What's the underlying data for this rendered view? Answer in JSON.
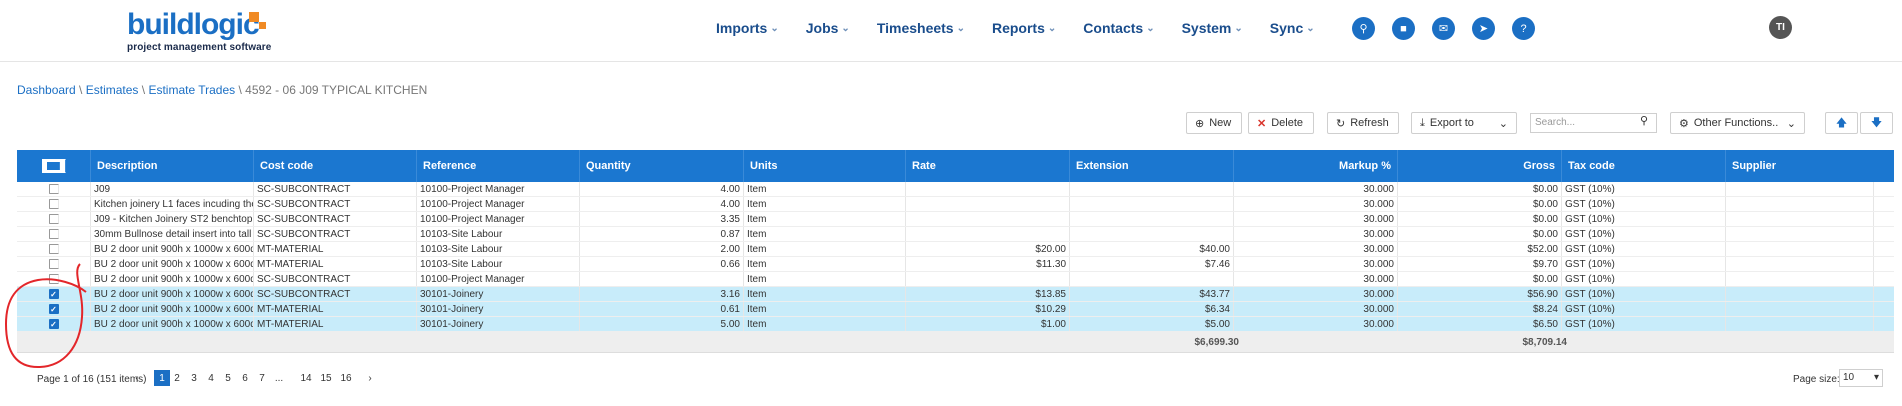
{
  "brand": {
    "name": "buildlogic",
    "tagline": "project management software",
    "accent": "#1b6fc4",
    "orange": "#f08a24"
  },
  "nav": [
    "Imports",
    "Jobs",
    "Timesheets",
    "Reports",
    "Contacts",
    "System",
    "Sync"
  ],
  "nav_icons": [
    "search-icon",
    "folder-icon",
    "mail-icon",
    "send-icon",
    "help-icon"
  ],
  "user_initials": "TI",
  "breadcrumb": {
    "dashboard": "Dashboard",
    "estimates": "Estimates",
    "estimate_trades": "Estimate Trades",
    "current": "4592 - 06 J09 TYPICAL KITCHEN",
    "sep": " \\ "
  },
  "toolbar": {
    "new": "New",
    "delete": "Delete",
    "refresh": "Refresh",
    "export": "Export to",
    "search_placeholder": "Search...",
    "other": "Other Functions.."
  },
  "columns": [
    "Description",
    "Cost code",
    "Reference",
    "Quantity",
    "Units",
    "Rate",
    "Extension",
    "Markup %",
    "Gross",
    "Tax code",
    "Supplier"
  ],
  "rows": [
    {
      "checked": false,
      "selected": false,
      "desc": "J09",
      "cost": "SC-SUBCONTRACT",
      "ref": "10100-Project Manager",
      "qty": "4.00",
      "units": "Item",
      "rate": "",
      "ext": "",
      "markup": "30.000",
      "gross": "$0.00",
      "tax": "GST (10%)"
    },
    {
      "checked": false,
      "selected": false,
      "desc": "Kitchen joinery L1 faces incuding the",
      "cost": "SC-SUBCONTRACT",
      "ref": "10100-Project Manager",
      "qty": "4.00",
      "units": "Item",
      "rate": "",
      "ext": "",
      "markup": "30.000",
      "gross": "$0.00",
      "tax": "GST (10%)"
    },
    {
      "checked": false,
      "selected": false,
      "desc": "J09 - Kitchen Joinery ST2 benchtop 8",
      "cost": "SC-SUBCONTRACT",
      "ref": "10100-Project Manager",
      "qty": "3.35",
      "units": "Item",
      "rate": "",
      "ext": "",
      "markup": "30.000",
      "gross": "$0.00",
      "tax": "GST (10%)"
    },
    {
      "checked": false,
      "selected": false,
      "desc": "30mm Bullnose detail insert into tall c",
      "cost": "SC-SUBCONTRACT",
      "ref": "10103-Site Labour",
      "qty": "0.87",
      "units": "Item",
      "rate": "",
      "ext": "",
      "markup": "30.000",
      "gross": "$0.00",
      "tax": "GST (10%)"
    },
    {
      "checked": false,
      "selected": false,
      "desc": "BU 2 door unit 900h x 1000w x 600d",
      "cost": "MT-MATERIAL",
      "ref": "10103-Site Labour",
      "qty": "2.00",
      "units": "Item",
      "rate": "$20.00",
      "ext": "$40.00",
      "markup": "30.000",
      "gross": "$52.00",
      "tax": "GST (10%)"
    },
    {
      "checked": false,
      "selected": false,
      "desc": "BU 2 door unit 900h x 1000w x 600d",
      "cost": "MT-MATERIAL",
      "ref": "10103-Site Labour",
      "qty": "0.66",
      "units": "Item",
      "rate": "$11.30",
      "ext": "$7.46",
      "markup": "30.000",
      "gross": "$9.70",
      "tax": "GST (10%)"
    },
    {
      "checked": false,
      "selected": false,
      "desc": "BU 2 door unit 900h x 1000w x 600d",
      "cost": "SC-SUBCONTRACT",
      "ref": "10100-Project Manager",
      "qty": "",
      "units": "Item",
      "rate": "",
      "ext": "",
      "markup": "30.000",
      "gross": "$0.00",
      "tax": "GST (10%)"
    },
    {
      "checked": true,
      "selected": true,
      "desc": "BU 2 door unit 900h x 1000w x 600d",
      "cost": "SC-SUBCONTRACT",
      "ref": "30101-Joinery",
      "qty": "3.16",
      "units": "Item",
      "rate": "$13.85",
      "ext": "$43.77",
      "markup": "30.000",
      "gross": "$56.90",
      "tax": "GST (10%)"
    },
    {
      "checked": true,
      "selected": true,
      "desc": "BU 2 door unit 900h x 1000w x 600d",
      "cost": "MT-MATERIAL",
      "ref": "30101-Joinery",
      "qty": "0.61",
      "units": "Item",
      "rate": "$10.29",
      "ext": "$6.34",
      "markup": "30.000",
      "gross": "$8.24",
      "tax": "GST (10%)"
    },
    {
      "checked": true,
      "selected": true,
      "desc": "BU 2 door unit 900h x 1000w x 600d",
      "cost": "MT-MATERIAL",
      "ref": "30101-Joinery",
      "qty": "5.00",
      "units": "Item",
      "rate": "$1.00",
      "ext": "$5.00",
      "markup": "30.000",
      "gross": "$6.50",
      "tax": "GST (10%)"
    }
  ],
  "totals": {
    "extension": "$6,699.30",
    "gross": "$8,709.14"
  },
  "pager": {
    "info": "Page 1 of 16 (151 items)",
    "pages": [
      "1",
      "2",
      "3",
      "4",
      "5",
      "6",
      "7",
      "...",
      "14",
      "15",
      "16"
    ],
    "current": "1",
    "size_label": "Page size:",
    "size": "10"
  }
}
